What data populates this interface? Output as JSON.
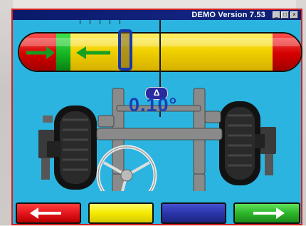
{
  "window": {
    "title": "DEMO Version 7.53",
    "minimize_label": "_",
    "maximize_label": "□",
    "close_label": "×"
  },
  "gauge": {
    "zones": [
      "red",
      "green",
      "yellow",
      "red"
    ],
    "arrow_direction": "left",
    "target_position": 0.37
  },
  "readout": {
    "delta_symbol": "Δ",
    "value": "0.10°"
  },
  "toolbar": {
    "buttons": [
      {
        "name": "back",
        "icon": "arrow-left-icon",
        "color": "#e3161b"
      },
      {
        "name": "yellow",
        "icon": "",
        "color": "#f5e900"
      },
      {
        "name": "blue",
        "icon": "",
        "color": "#2b35a9"
      },
      {
        "name": "forward",
        "icon": "arrow-right-icon",
        "color": "#2db52a"
      }
    ]
  },
  "colors": {
    "background": "#2bb4df",
    "title_bar": "#0b1d72",
    "readout": "#1a3fb6"
  }
}
